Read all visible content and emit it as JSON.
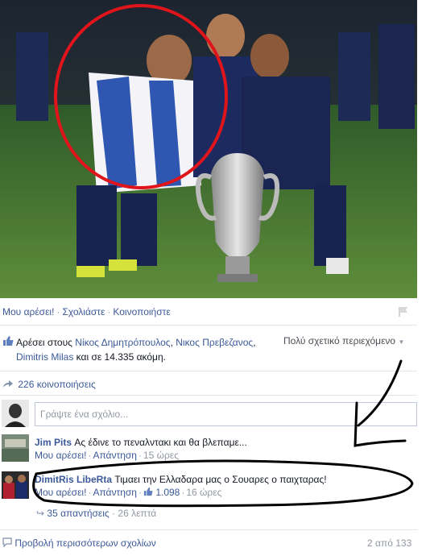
{
  "post_actions": {
    "like": "Μου αρέσει!",
    "comment": "Σχολιάστε",
    "share": "Κοινοποιήστε"
  },
  "likes": {
    "prefix": "Αρέσει στους",
    "names": [
      "Νίκος Δημητρόπουλος",
      "Νικος Πρεβεζανος",
      "Dimitris Milas"
    ],
    "suffix": "και σε 14.335 ακόμη.",
    "relevance": "Πολύ σχετικό περιεχόμενο"
  },
  "shares": {
    "label": "226 κοινοποιήσεις"
  },
  "comment_input": {
    "placeholder": "Γράψτε ένα σχόλιο..."
  },
  "comments": [
    {
      "author": "Jim Pits",
      "text": "Ας έδινε το πεναλντακι και θα βλεπαμε...",
      "like": "Μου αρέσει!",
      "reply": "Απάντηση",
      "time": "15 ώρες"
    },
    {
      "author": "DimitRis LibeRta",
      "text": "Τιμαει την Ελλαδαρα μας ο Σουαρες ο παιχταρας!",
      "like": "Μου αρέσει!",
      "reply": "Απάντηση",
      "like_count": "1.098",
      "time": "16 ώρες"
    }
  ],
  "replies": {
    "label": "35 απαντήσεις",
    "time": "26 λεπτά"
  },
  "footer": {
    "more": "Προβολή περισσότερων σχολίων",
    "count": "2 από 133"
  },
  "colors": {
    "link": "#3b5998",
    "annotation_red": "#e0141b",
    "annotation_black": "#000000"
  }
}
